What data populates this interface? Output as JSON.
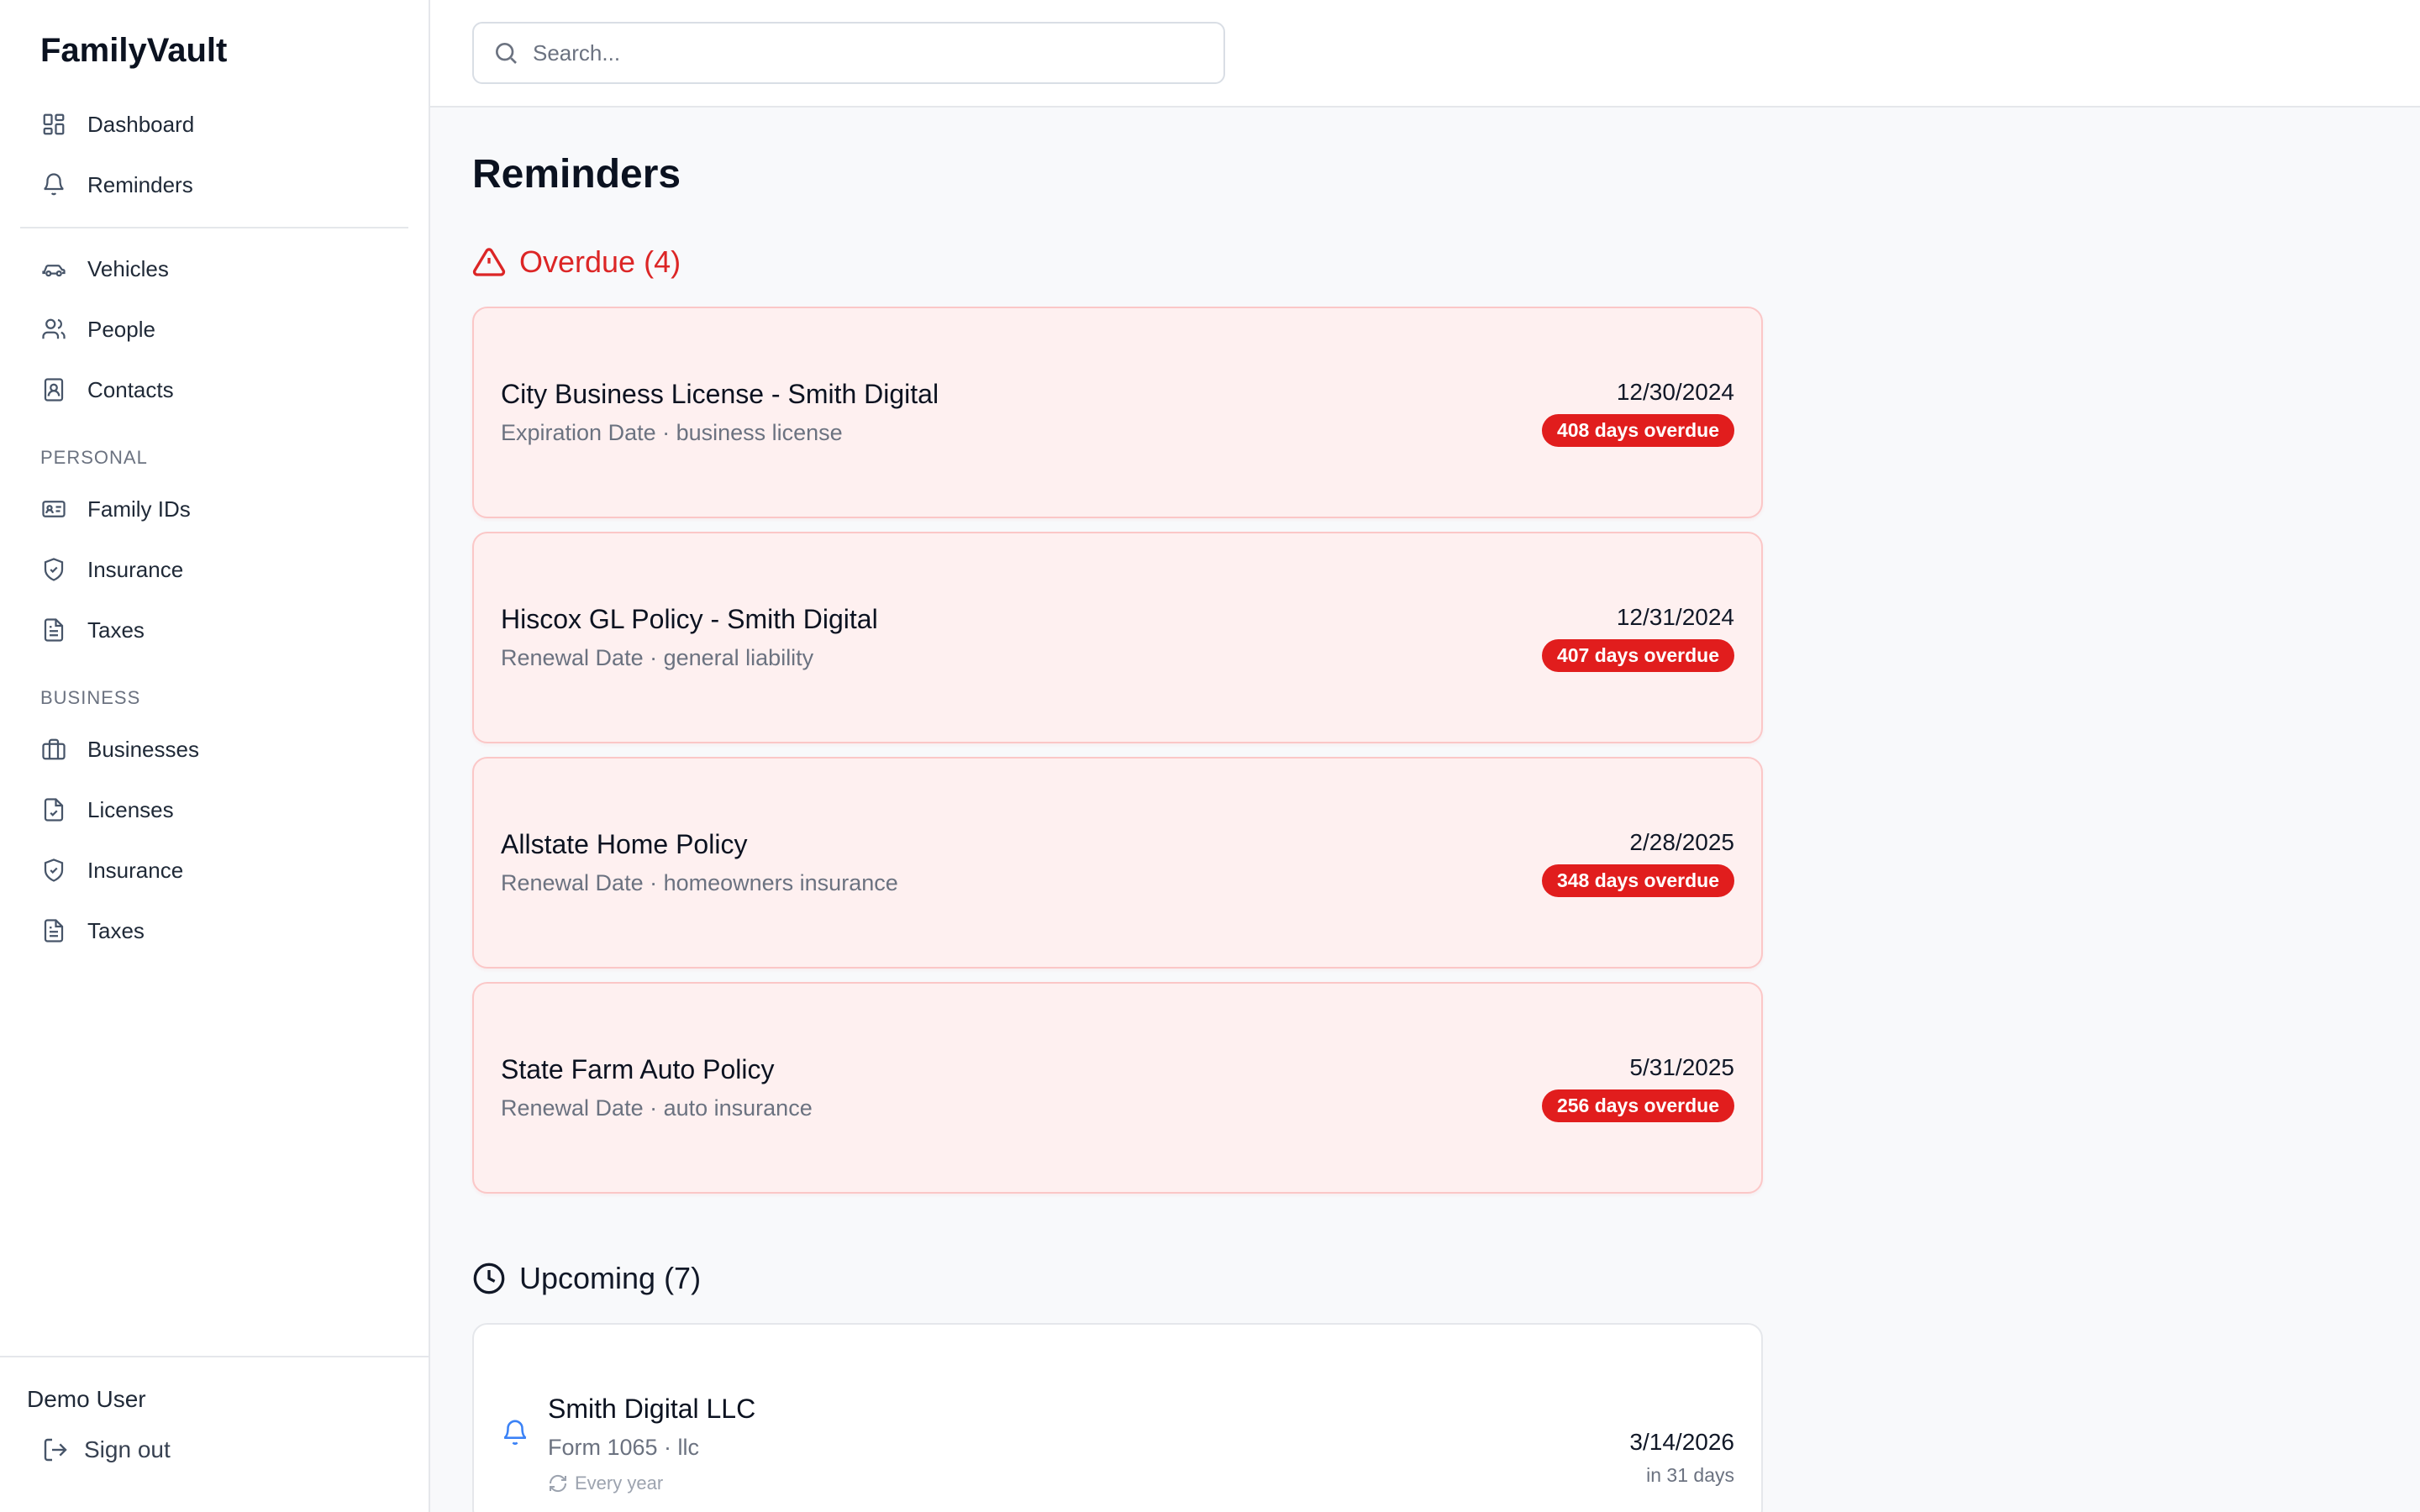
{
  "app": {
    "title": "FamilyVault"
  },
  "sidebar": {
    "main_items": [
      {
        "label": "Dashboard",
        "icon": "dashboard-icon"
      },
      {
        "label": "Reminders",
        "icon": "bell-icon"
      }
    ],
    "records_items": [
      {
        "label": "Vehicles",
        "icon": "car-icon"
      },
      {
        "label": "People",
        "icon": "users-icon"
      },
      {
        "label": "Contacts",
        "icon": "contact-book-icon"
      }
    ],
    "personal_label": "PERSONAL",
    "personal_items": [
      {
        "label": "Family IDs",
        "icon": "id-card-icon"
      },
      {
        "label": "Insurance",
        "icon": "shield-check-icon"
      },
      {
        "label": "Taxes",
        "icon": "document-icon"
      }
    ],
    "business_label": "BUSINESS",
    "business_items": [
      {
        "label": "Businesses",
        "icon": "briefcase-icon"
      },
      {
        "label": "Licenses",
        "icon": "file-check-icon"
      },
      {
        "label": "Insurance",
        "icon": "shield-check-icon"
      },
      {
        "label": "Taxes",
        "icon": "document-icon"
      }
    ],
    "user": {
      "name": "Demo User",
      "signout_label": "Sign out"
    }
  },
  "search": {
    "placeholder": "Search..."
  },
  "page": {
    "title": "Reminders"
  },
  "overdue": {
    "heading": "Overdue (4)",
    "items": [
      {
        "title": "City Business License - Smith Digital",
        "subtitle": "Expiration Date · business license",
        "date": "12/30/2024",
        "badge": "408 days overdue"
      },
      {
        "title": "Hiscox GL Policy - Smith Digital",
        "subtitle": "Renewal Date · general liability",
        "date": "12/31/2024",
        "badge": "407 days overdue"
      },
      {
        "title": "Allstate Home Policy",
        "subtitle": "Renewal Date · homeowners insurance",
        "date": "2/28/2025",
        "badge": "348 days overdue"
      },
      {
        "title": "State Farm Auto Policy",
        "subtitle": "Renewal Date · auto insurance",
        "date": "5/31/2025",
        "badge": "256 days overdue"
      }
    ]
  },
  "upcoming": {
    "heading": "Upcoming (7)",
    "items": [
      {
        "title": "Smith Digital LLC",
        "subtitle": "Form 1065 · llc",
        "recurrence": "Every year",
        "date": "3/14/2026",
        "relative": "in 31 days"
      }
    ]
  },
  "colors": {
    "overdue_red": "#dc2626",
    "badge_red": "#e11d1d",
    "overdue_card_bg": "#fef0f0",
    "bell_blue": "#3b82f6"
  }
}
